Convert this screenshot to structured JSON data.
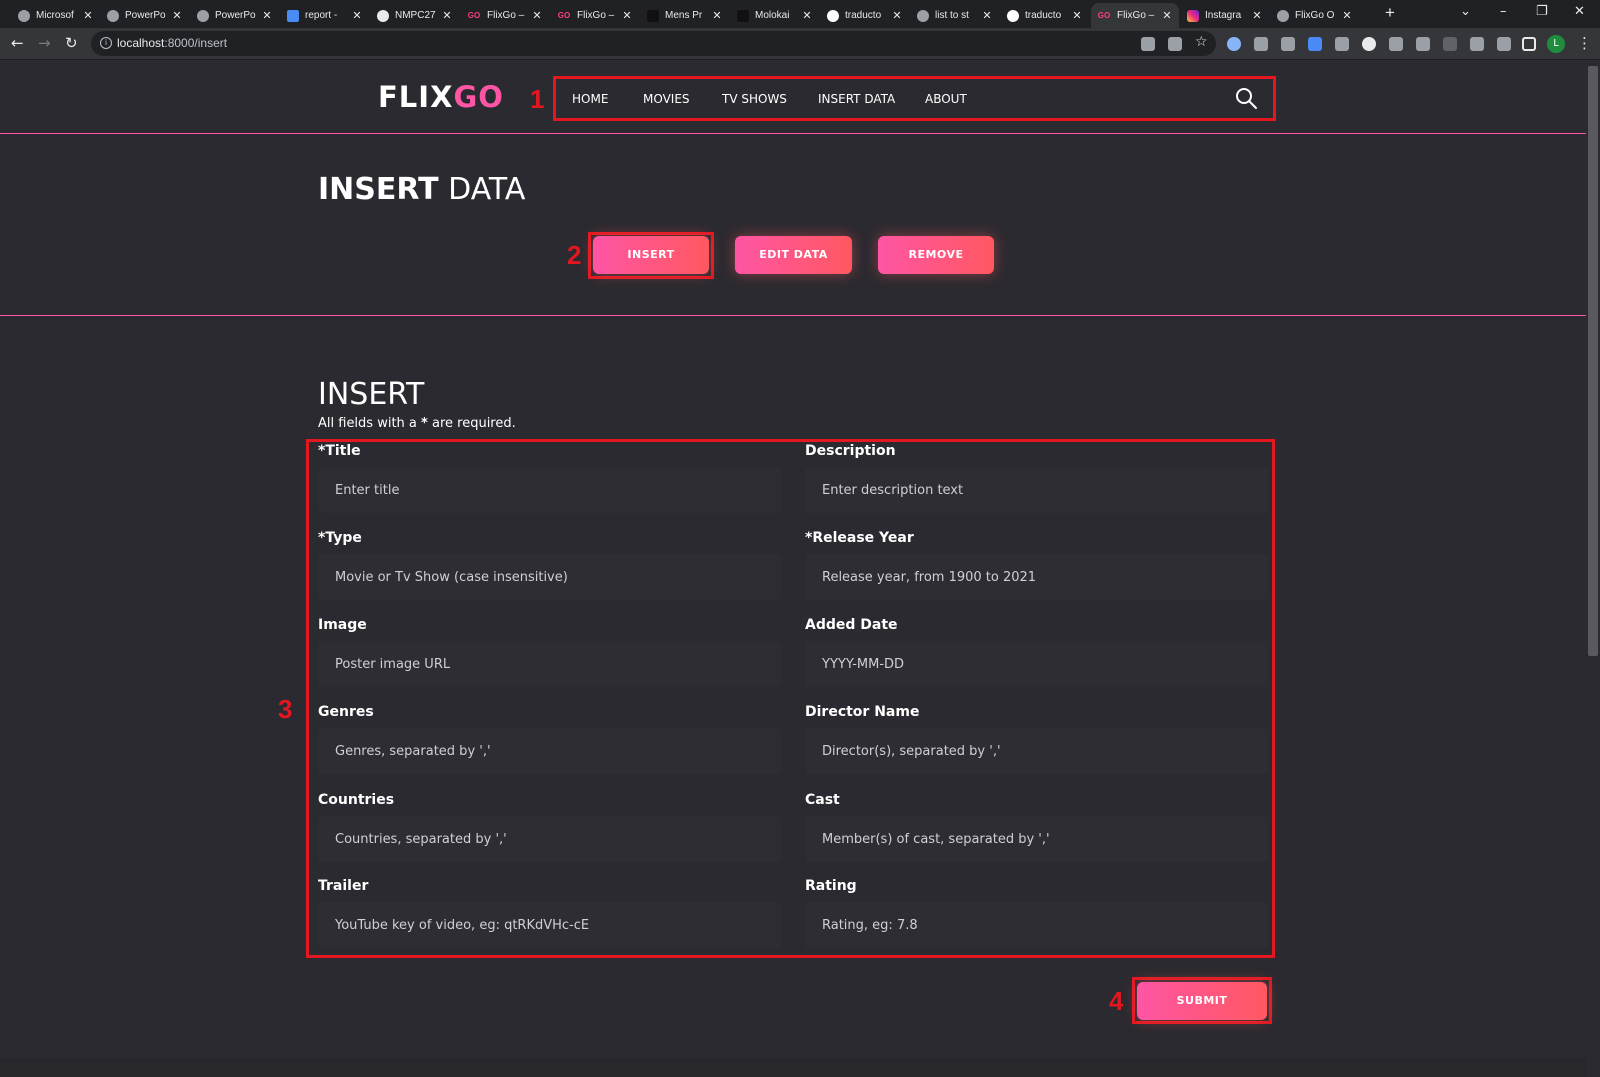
{
  "browser": {
    "tabs": [
      {
        "label": "Microsof",
        "icon": "globe-icon"
      },
      {
        "label": "PowerPo",
        "icon": "globe-icon"
      },
      {
        "label": "PowerPo",
        "icon": "globe-icon"
      },
      {
        "label": "report -",
        "icon": "doc-icon"
      },
      {
        "label": "NMPC27",
        "icon": "github-icon"
      },
      {
        "label": "FlixGo –",
        "icon": "flixgo-icon"
      },
      {
        "label": "FlixGo –",
        "icon": "flixgo-icon"
      },
      {
        "label": "Mens Pr",
        "icon": "shoe-icon"
      },
      {
        "label": "Molokai",
        "icon": "shoe-icon"
      },
      {
        "label": "traducto",
        "icon": "google-icon"
      },
      {
        "label": "list to st",
        "icon": "globe-icon"
      },
      {
        "label": "traducto",
        "icon": "google-icon"
      },
      {
        "label": "FlixGo –",
        "icon": "flixgo-icon",
        "active": true
      },
      {
        "label": "Instagra",
        "icon": "instagram-icon"
      },
      {
        "label": "FlixGo O",
        "icon": "globe-icon"
      }
    ],
    "new_tab": "+",
    "url_host": "localhost",
    "url_path": ":8000/insert",
    "profile_initial": "L"
  },
  "header": {
    "logo_part1": "FLIX",
    "logo_part2": "GO",
    "menu": [
      "HOME",
      "MOVIES",
      "TV SHOWS",
      "INSERT DATA",
      "ABOUT"
    ]
  },
  "annotations": [
    "1",
    "2",
    "3",
    "4"
  ],
  "section": {
    "title_bold": "INSERT",
    "title_light": "DATA",
    "buttons": [
      "INSERT",
      "EDIT DATA",
      "REMOVE"
    ]
  },
  "form": {
    "title": "INSERT",
    "note_prefix": "All fields with a",
    "note_star": "*",
    "note_suffix": "are required.",
    "fields": [
      {
        "label": "*Title",
        "placeholder": "Enter title"
      },
      {
        "label": "Description",
        "placeholder": "Enter description text"
      },
      {
        "label": "*Type",
        "placeholder": "Movie or Tv Show (case insensitive)"
      },
      {
        "label": "*Release Year",
        "placeholder": "Release year, from 1900 to 2021"
      },
      {
        "label": "Image",
        "placeholder": "Poster image URL"
      },
      {
        "label": "Added Date",
        "placeholder": "YYYY-MM-DD"
      },
      {
        "label": "Genres",
        "placeholder": "Genres, separated by ','"
      },
      {
        "label": "Director Name",
        "placeholder": "Director(s), separated by ','"
      },
      {
        "label": "Countries",
        "placeholder": "Countries, separated by ','"
      },
      {
        "label": "Cast",
        "placeholder": "Member(s) of cast, separated by ','"
      },
      {
        "label": "Trailer",
        "placeholder": "YouTube key of video, eg: qtRKdVHc-cE"
      },
      {
        "label": "Rating",
        "placeholder": "Rating, eg: 7.8"
      }
    ],
    "submit": "SUBMIT"
  },
  "colors": {
    "accent": "#ff55a5",
    "accent2": "#ff5860",
    "highlight": "#e2171f",
    "background": "#2b2a30"
  }
}
